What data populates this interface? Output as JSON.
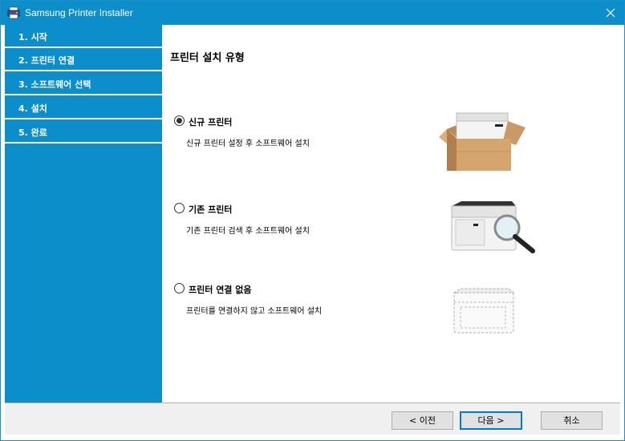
{
  "window": {
    "title": "Samsung Printer Installer"
  },
  "sidebar": {
    "steps": [
      {
        "label": "1. 시작"
      },
      {
        "label": "2. 프린터 연결"
      },
      {
        "label": "3. 소프트웨어 선택"
      },
      {
        "label": "4. 설치"
      },
      {
        "label": "5. 완료"
      }
    ]
  },
  "content": {
    "title": "프린터 설치 유형",
    "options": [
      {
        "label": "신규 프린터",
        "description": "신규 프린터 설정 후 소프트웨어 설치",
        "selected": true
      },
      {
        "label": "기존 프린터",
        "description": "기존 프린터 검색 후 소프트웨어 설치",
        "selected": false
      },
      {
        "label": "프린터 연결 없음",
        "description": "프린터를 연결하지 않고 소프트웨어 설치",
        "selected": false
      }
    ]
  },
  "footer": {
    "back_label": "< 이전",
    "next_label": "다음 >",
    "cancel_label": "취소"
  },
  "colors": {
    "accent": "#0b8ec9",
    "default_button_border": "#0078d7"
  }
}
